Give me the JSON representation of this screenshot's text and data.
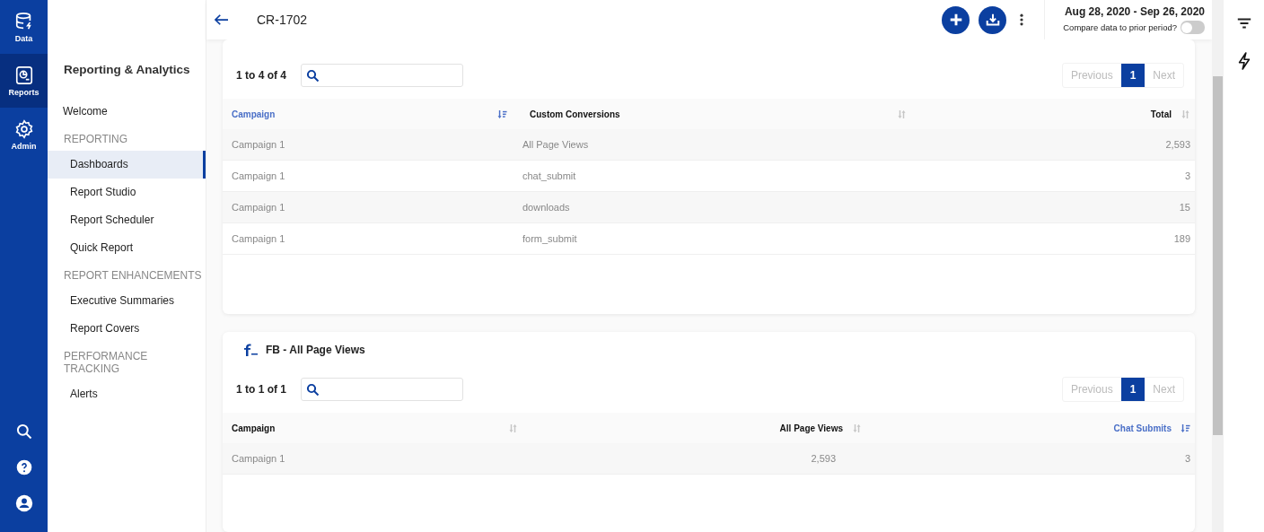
{
  "rail": {
    "items": [
      {
        "label": "Data",
        "selected": false
      },
      {
        "label": "Reports",
        "selected": true
      },
      {
        "label": "Admin",
        "selected": false
      }
    ]
  },
  "sidebar": {
    "title": "Reporting & Analytics",
    "items": [
      {
        "kind": "top",
        "label": "Welcome",
        "selected": false
      },
      {
        "kind": "header",
        "label": "REPORTING"
      },
      {
        "kind": "link",
        "label": "Dashboards",
        "selected": true
      },
      {
        "kind": "link",
        "label": "Report Studio",
        "selected": false
      },
      {
        "kind": "link",
        "label": "Report Scheduler",
        "selected": false
      },
      {
        "kind": "link",
        "label": "Quick Report",
        "selected": false
      },
      {
        "kind": "header",
        "label": "REPORT ENHANCEMENTS"
      },
      {
        "kind": "link",
        "label": "Executive Summaries",
        "selected": false
      },
      {
        "kind": "link",
        "label": "Report Covers",
        "selected": false
      },
      {
        "kind": "header",
        "label": "PERFORMANCE TRACKING"
      },
      {
        "kind": "link",
        "label": "Alerts",
        "selected": false
      }
    ]
  },
  "header": {
    "title": "CR-1702",
    "date_range": "Aug 28, 2020 - Sep 26, 2020",
    "compare_label": "Compare data to prior period?",
    "compare_on": false
  },
  "cards": [
    {
      "count": "1 to 4 of 4",
      "pagination": {
        "previous": "Previous",
        "next": "Next",
        "pages": [
          {
            "label": "1",
            "selected": true
          }
        ]
      },
      "columns": [
        {
          "label": "Campaign",
          "kind": "text",
          "sorted": true
        },
        {
          "label": "Custom Conversions",
          "kind": "text",
          "sorted": false
        },
        {
          "label": "Total",
          "kind": "number",
          "sorted": false
        }
      ],
      "rows": [
        [
          "Campaign 1",
          "All Page Views",
          "2,593"
        ],
        [
          "Campaign 1",
          "chat_submit",
          "3"
        ],
        [
          "Campaign 1",
          "downloads",
          "15"
        ],
        [
          "Campaign 1",
          "form_submit",
          "189"
        ]
      ]
    },
    {
      "title": "FB - All Page Views",
      "count": "1 to 1 of 1",
      "pagination": {
        "previous": "Previous",
        "next": "Next",
        "pages": [
          {
            "label": "1",
            "selected": true
          }
        ]
      },
      "columns": [
        {
          "label": "Campaign",
          "kind": "text",
          "sorted": false
        },
        {
          "label": "All Page Views",
          "kind": "number",
          "sorted": false
        },
        {
          "label": "Chat Submits",
          "kind": "number",
          "sorted": true
        }
      ],
      "rows": [
        [
          "Campaign 1",
          "2,593",
          "3"
        ]
      ]
    }
  ]
}
